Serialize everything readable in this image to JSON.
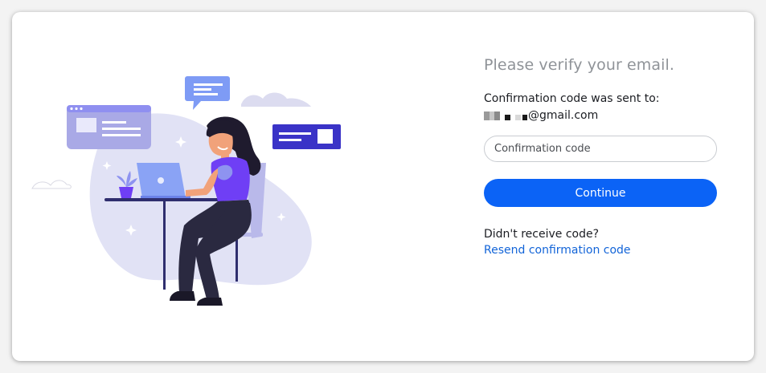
{
  "verify": {
    "title": "Please verify your email.",
    "sent_label": "Confirmation code was sent to:",
    "email_suffix": "@gmail.com",
    "code_placeholder": "Confirmation code",
    "continue_label": "Continue",
    "didnt_receive": "Didn't receive code?",
    "resend_label": "Resend confirmation code"
  },
  "colors": {
    "primary": "#0b63f6",
    "link": "#1264d8",
    "title_gray": "#8f9398",
    "illustration_blob": "#e1e2f5",
    "illustration_purple": "#6f3ff5",
    "illustration_navy": "#2f2e6e"
  },
  "icons": {
    "illustration": "woman-working-on-laptop-illustration"
  }
}
